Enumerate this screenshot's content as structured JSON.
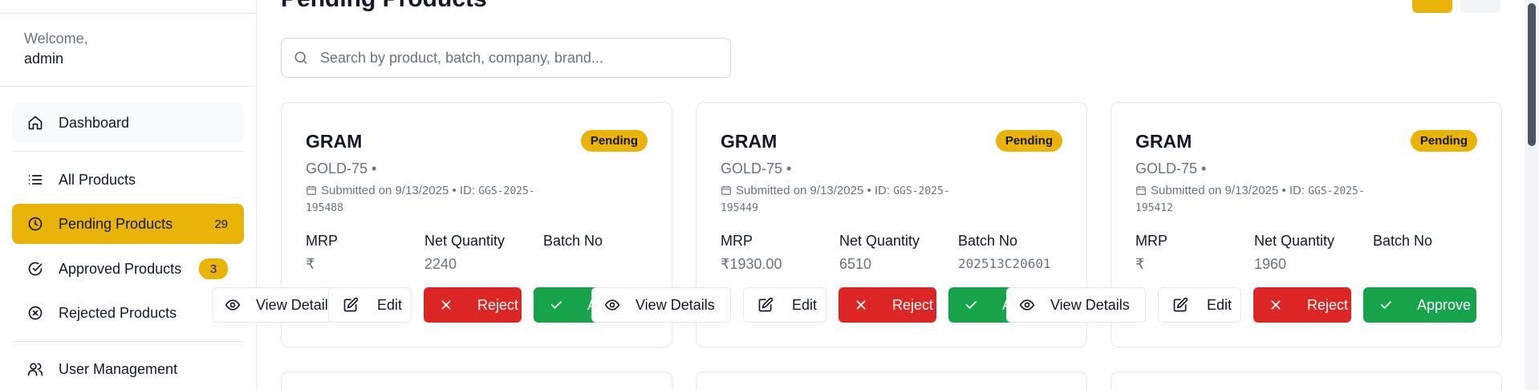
{
  "sidebar": {
    "welcome": "Welcome,",
    "username": "admin",
    "items": [
      {
        "label": "Dashboard"
      },
      {
        "label": "All Products"
      },
      {
        "label": "Pending Products",
        "count": "29"
      },
      {
        "label": "Approved Products",
        "count": "3"
      },
      {
        "label": "Rejected Products"
      },
      {
        "label": "User Management"
      }
    ]
  },
  "main": {
    "title": "Pending Products",
    "search_placeholder": "Search by product, batch, company, brand...",
    "cards": [
      {
        "name": "GRAM",
        "status": "Pending",
        "brand": "GOLD-75 •",
        "submitted": "Submitted on 9/13/2025 • ID:",
        "id_code": "GGS-2025-195488",
        "mrp_label": "MRP",
        "mrp": "₹",
        "qty_label": "Net Quantity",
        "qty": "2240",
        "batch_label": "Batch No",
        "batch": ""
      },
      {
        "name": "GRAM",
        "status": "Pending",
        "brand": "GOLD-75 •",
        "submitted": "Submitted on 9/13/2025 • ID:",
        "id_code": "GGS-2025-195449",
        "mrp_label": "MRP",
        "mrp": "₹1930.00",
        "qty_label": "Net Quantity",
        "qty": "6510",
        "batch_label": "Batch No",
        "batch": "202513C20601"
      },
      {
        "name": "GRAM",
        "status": "Pending",
        "brand": "GOLD-75 •",
        "submitted": "Submitted on 9/13/2025 • ID:",
        "id_code": "GGS-2025-195412",
        "mrp_label": "MRP",
        "mrp": "₹",
        "qty_label": "Net Quantity",
        "qty": "1960",
        "batch_label": "Batch No",
        "batch": ""
      }
    ],
    "actions": {
      "view": "View Details",
      "view_cut": "Details",
      "edit": "Edit",
      "reject": "Reject",
      "approve": "Approve"
    }
  },
  "colors": {
    "accent": "#eab308",
    "reject": "#dc2626",
    "approve": "#16a34a"
  },
  "icons": [
    "home-icon",
    "list-icon",
    "clock-icon",
    "check-circle-icon",
    "x-circle-icon",
    "users-icon",
    "search-icon",
    "calendar-icon",
    "eye-icon",
    "edit-icon",
    "x-icon",
    "check-icon"
  ]
}
